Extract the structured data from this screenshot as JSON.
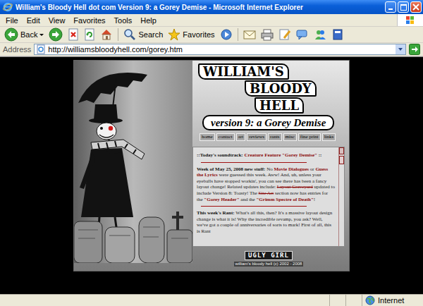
{
  "window": {
    "title": "William's Bloody Hell dot com Version 9: a Gorey Demise - Microsoft Internet Explorer"
  },
  "menu": [
    "File",
    "Edit",
    "View",
    "Favorites",
    "Tools",
    "Help"
  ],
  "toolbar": [
    {
      "kind": "back",
      "label": "Back"
    },
    {
      "kind": "forward"
    },
    {
      "kind": "stop"
    },
    {
      "kind": "refresh"
    },
    {
      "kind": "home"
    },
    {
      "kind": "separator"
    },
    {
      "kind": "search",
      "label": "Search"
    },
    {
      "kind": "favorites",
      "label": "Favorites"
    },
    {
      "kind": "media"
    },
    {
      "kind": "separator"
    },
    {
      "kind": "mail"
    },
    {
      "kind": "print"
    },
    {
      "kind": "edit"
    },
    {
      "kind": "discuss"
    },
    {
      "kind": "messenger"
    },
    {
      "kind": "research"
    }
  ],
  "address": {
    "label": "Address",
    "url": "http://williamsbloodyhell.com/gorey.htm"
  },
  "page": {
    "logo": [
      "WILLIAM'S",
      "BLOODY",
      "HELL"
    ],
    "subtitle": "version 9: a Gorey Demise",
    "nav": [
      "home",
      "contact",
      "art",
      "reviews",
      "rants",
      "misc",
      "fine print",
      "links"
    ],
    "soundtrack": [
      {
        "text": "::Today's soundtrack: ",
        "kind": "bold"
      },
      {
        "text": "Creature Feature \"Gorey Demise\"",
        "kind": "link"
      },
      {
        "text": " ::",
        "kind": "bold"
      }
    ],
    "news": [
      {
        "text": "Week of May 25, 2008 new stuff:",
        "kind": "bold"
      },
      {
        "text": " No ",
        "kind": "plain"
      },
      {
        "text": "Movie Dialogues",
        "kind": "link"
      },
      {
        "text": " or ",
        "kind": "plain"
      },
      {
        "text": "Guess the Lyrics",
        "kind": "link"
      },
      {
        "text": " were guessed this week. Aww! And, uh, unless your eyeballs have stopped workin', you can see there has been a fancy layout change! Related updates include: ",
        "kind": "plain"
      },
      {
        "text": "Layout Graveyard",
        "kind": "struck"
      },
      {
        "text": " updated to include Version 8: Toasty! The ",
        "kind": "plain"
      },
      {
        "text": "Site Art",
        "kind": "struck"
      },
      {
        "text": " section now has entries for the ",
        "kind": "plain"
      },
      {
        "text": "\"Gorey Header\"",
        "kind": "link"
      },
      {
        "text": " and the ",
        "kind": "plain"
      },
      {
        "text": "\"Grimm Spectre of Death\"",
        "kind": "link"
      },
      {
        "text": "!",
        "kind": "plain"
      }
    ],
    "rant": [
      {
        "text": "This week's Rant:",
        "kind": "bold"
      },
      {
        "text": " What's all this, then? It's a massive layout design change is what it is! Why the incredible revamp, you ask? Well, we've got a couple of anniversaries of sorts to mark! First of all, this is Rant",
        "kind": "plain"
      }
    ],
    "badge": "UGLY GIRL",
    "copyright": "william's bloody hell (c) 2002 - 2008"
  },
  "status_bar": {
    "zone": "Internet"
  }
}
